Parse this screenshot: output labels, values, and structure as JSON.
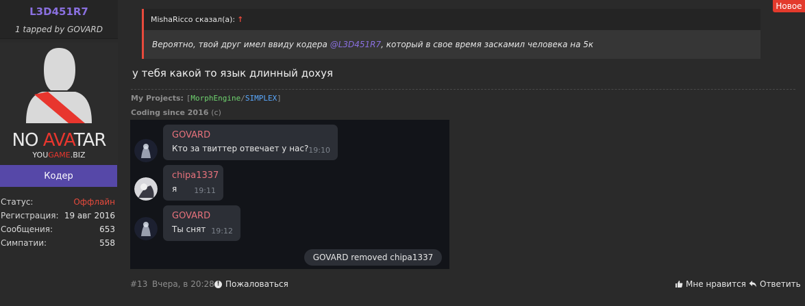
{
  "user": {
    "name": "L3D451R7",
    "title": "1 tapped by GOVARD",
    "avatar": {
      "text_no": "NO ",
      "text_ava": "AVA",
      "text_tar": "TAR",
      "text_you": "YOU",
      "text_game": "GAME",
      "text_biz": ".BIZ"
    },
    "rank": "Кодер",
    "stats": [
      {
        "label": "Статус:",
        "value": "Оффлайн"
      },
      {
        "label": "Регистрация:",
        "value": "19 авг 2016"
      },
      {
        "label": "Сообщения:",
        "value": "653"
      },
      {
        "label": "Симпатии:",
        "value": "558"
      }
    ]
  },
  "badge_new": "Новое",
  "quote": {
    "author_line": "MishaRicco сказал(а):",
    "arrow": "↑",
    "text_before": "Вероятно, твой друг имел ввиду кодера ",
    "mention": "@L3D451R7",
    "text_after": ", который в свое время заскамил человека на 5к"
  },
  "post_text": "у тебя какой то язык длинный дохуя",
  "signature": {
    "projects_label": "My Projects:",
    "bracket_open": "[",
    "project1": "MorphEngine",
    "slash": "/",
    "project2": "SIMPLEX",
    "bracket_close": "]",
    "coding_since": "Coding since 2016",
    "copyright": "(c)"
  },
  "chat": {
    "messages": [
      {
        "name": "GOVARD",
        "text": "Кто за твиттер отвечает у нас?",
        "time": "19:10"
      },
      {
        "name": "chipa1337",
        "text": "я",
        "time": "19:11"
      },
      {
        "name": "GOVARD",
        "text": "Ты снят",
        "time": "19:12"
      }
    ],
    "service_message": "GOVARD removed chipa1337"
  },
  "footer": {
    "post_number": "#13",
    "date": "Вчера, в 20:28",
    "report": "Пожаловаться",
    "like": "Мне нравится",
    "reply": "Ответить"
  },
  "colors": {
    "accent_purple": "#8a70e0",
    "accent_red": "#e84a3c",
    "rank_bg": "#5648a8",
    "chat_name": "#e8727c"
  }
}
